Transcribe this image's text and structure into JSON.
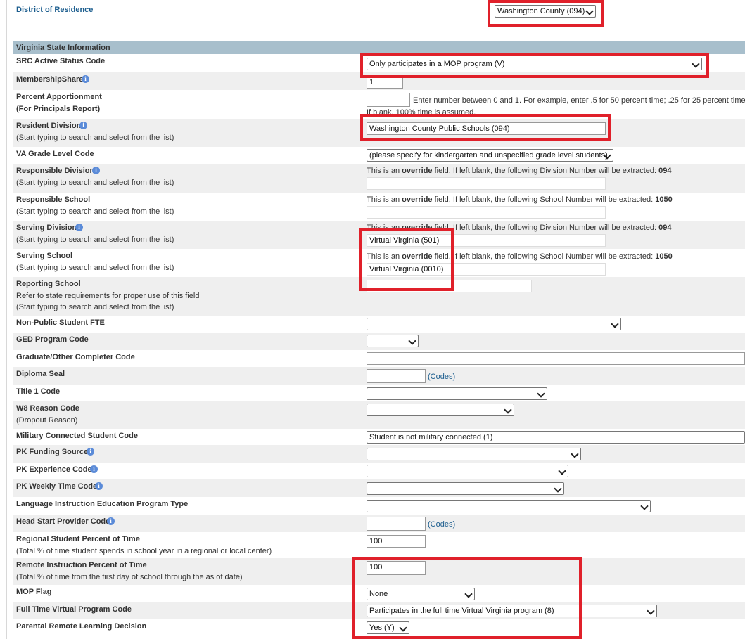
{
  "district": {
    "label": "District of Residence",
    "value": "Washington County (094)"
  },
  "section_title": "Virginia State Information",
  "src_active": {
    "label": "SRC Active Status Code",
    "value": "Only participates in a MOP program (V)"
  },
  "membership_share": {
    "label": "MembershipShare",
    "value": "1"
  },
  "percent_apportionment": {
    "label": "Percent Apportionment",
    "sub": "(For Principals Report)",
    "value": "",
    "help": "Enter number between 0 and 1. For example, enter .5 for 50 percent time; .25 for 25 percent time.",
    "help2": "If blank, 100% time is assumed."
  },
  "resident_division": {
    "label": "Resident Division",
    "sub": "(Start typing to search and select from the list)",
    "value": "Washington County Public Schools (094)"
  },
  "va_grade": {
    "label": "VA Grade Level Code",
    "value": "(please specify for kindergarten and unspecified grade level students)"
  },
  "responsible_division": {
    "label": "Responsible Division",
    "sub": "(Start typing to search and select from the list)",
    "note_pre": "This is an ",
    "note_bold": "override",
    "note_post": " field. If left blank, the following Division Number will be extracted: ",
    "note_num": "094",
    "value": ""
  },
  "responsible_school": {
    "label": "Responsible School",
    "sub": "(Start typing to search and select from the list)",
    "note_pre": "This is an ",
    "note_bold": "override",
    "note_post": " field. If left blank, the following School Number will be extracted: ",
    "note_num": "1050",
    "value": ""
  },
  "serving_division": {
    "label": "Serving Division",
    "sub": "(Start typing to search and select from the list)",
    "note_pre": "This is an ",
    "note_bold": "override",
    "note_post": " field. If left blank, the following Division Number will be extracted: ",
    "note_num": "094",
    "value": "Virtual Virginia (501)"
  },
  "serving_school": {
    "label": "Serving School",
    "sub": "(Start typing to search and select from the list)",
    "note_pre": "This is an ",
    "note_bold": "override",
    "note_post": " field. If left blank, the following School Number will be extracted: ",
    "note_num": "1050",
    "value": "Virtual Virginia (0010)"
  },
  "reporting_school": {
    "label": "Reporting School",
    "sub1": "Refer to state requirements for proper use of this field",
    "sub2": "(Start typing to search and select from the list)",
    "value": ""
  },
  "non_public_fte": {
    "label": "Non-Public Student FTE",
    "value": ""
  },
  "ged_program": {
    "label": "GED Program Code",
    "value": ""
  },
  "graduate_code": {
    "label": "Graduate/Other Completer Code",
    "value": ""
  },
  "diploma_seal": {
    "label": "Diploma Seal",
    "value": "",
    "codes": "(Codes)"
  },
  "title1": {
    "label": "Title 1 Code",
    "value": ""
  },
  "w8_reason": {
    "label": "W8 Reason Code",
    "sub": "(Dropout Reason)",
    "value": ""
  },
  "military": {
    "label": "Military Connected Student Code",
    "value": "Student is not military connected (1)"
  },
  "pk_funding": {
    "label": "PK Funding Source",
    "value": ""
  },
  "pk_experience": {
    "label": "PK Experience Code",
    "value": ""
  },
  "pk_weekly": {
    "label": "PK Weekly Time Code",
    "value": ""
  },
  "language_program": {
    "label": "Language Instruction Education Program Type",
    "value": ""
  },
  "head_start": {
    "label": "Head Start Provider Code",
    "value": "",
    "codes": "(Codes)"
  },
  "regional_percent": {
    "label": "Regional Student Percent of Time",
    "sub": "(Total % of time student spends in school year in a regional or local center)",
    "value": "100"
  },
  "remote_percent": {
    "label": "Remote Instruction Percent of Time",
    "sub": "(Total % of time from the first day of school through the as of date)",
    "value": "100"
  },
  "mop_flag": {
    "label": "MOP Flag",
    "value": "None"
  },
  "ftv_program": {
    "label": "Full Time Virtual Program Code",
    "value": "Participates in the full time Virtual Virginia program (8)"
  },
  "parental_remote": {
    "label": "Parental Remote Learning Decision",
    "value": "Yes (Y)"
  },
  "info_glyph": "i",
  "colors": {
    "header": "#a8bfcc",
    "highlight": "#e0202a",
    "link": "#1b5d8e"
  }
}
